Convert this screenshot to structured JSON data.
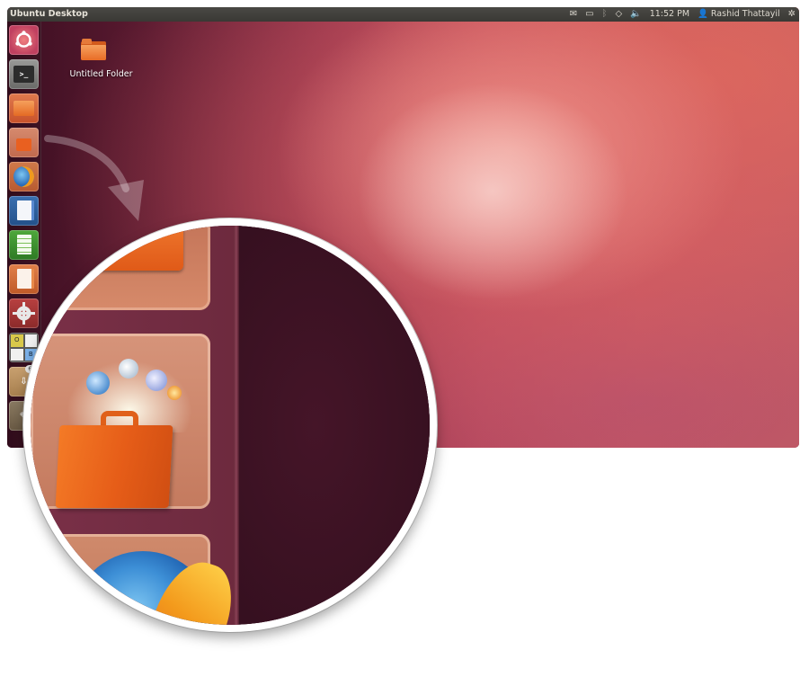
{
  "top_panel": {
    "title": "Ubuntu Desktop",
    "indicators": [
      "mail-icon",
      "battery-icon",
      "bluetooth-icon",
      "wifi-icon",
      "volume-icon"
    ],
    "clock": "11:52 PM",
    "user": "Rashid Thattayil",
    "session_icon": "gear-icon"
  },
  "launcher": {
    "items": [
      {
        "name": "dash-home",
        "icon": "ubuntu-logo-icon"
      },
      {
        "name": "terminal",
        "icon": "terminal-icon",
        "glyph": ">_"
      },
      {
        "name": "home-folder",
        "icon": "folder-icon"
      },
      {
        "name": "ubuntu-software-center",
        "icon": "shopping-bag-icon"
      },
      {
        "name": "firefox",
        "icon": "firefox-icon"
      },
      {
        "name": "libreoffice-writer",
        "icon": "writer-icon"
      },
      {
        "name": "libreoffice-calc",
        "icon": "calc-icon"
      },
      {
        "name": "libreoffice-impress",
        "icon": "impress-icon"
      },
      {
        "name": "system-settings",
        "icon": "settings-icon"
      },
      {
        "name": "workspace-switcher",
        "icon": "workspaces-icon"
      },
      {
        "name": "update-manager",
        "icon": "update-icon",
        "badge": "69"
      },
      {
        "name": "gimp",
        "icon": "gimp-icon"
      }
    ],
    "workspace_letters": [
      "O",
      "B"
    ]
  },
  "desktop": {
    "folder_label": "Untitled Folder"
  },
  "colors": {
    "panel_bg": "#3c3b37",
    "accent_orange": "#e95420",
    "wallpaper_dark": "#3d0f22",
    "wallpaper_light": "#f2b3aa"
  }
}
